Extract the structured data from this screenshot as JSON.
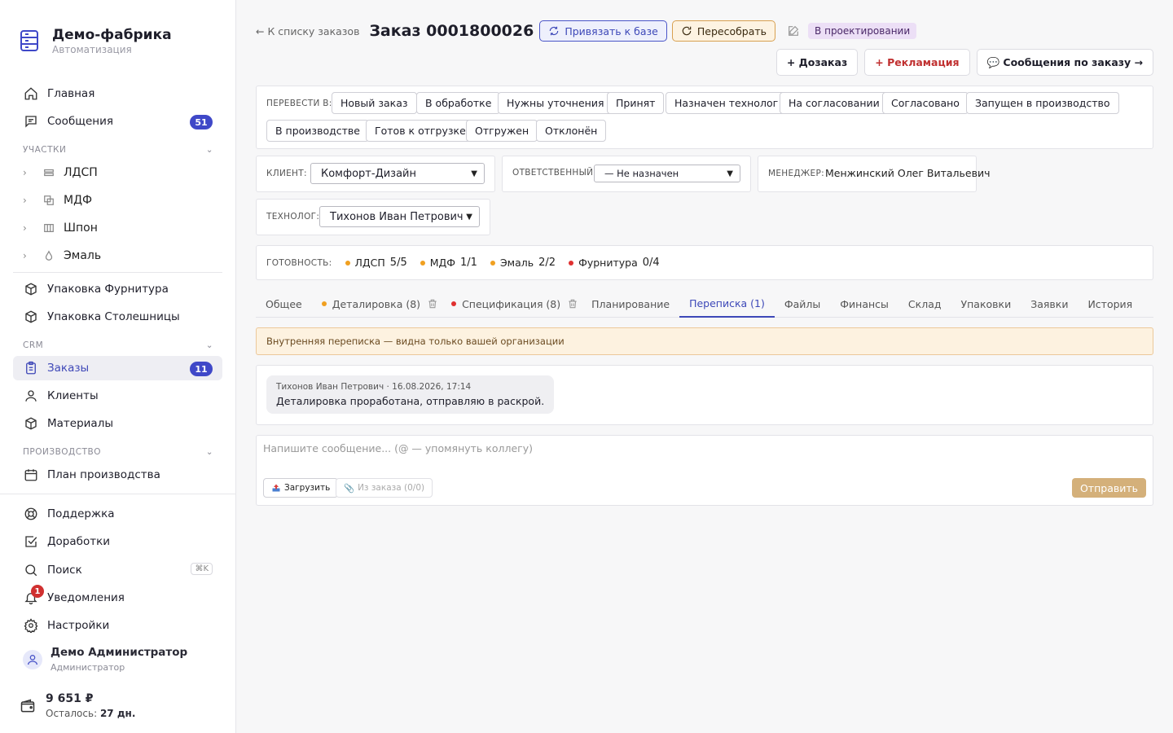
{
  "brand": {
    "name": "Демо-фабрика",
    "subtitle": "Автоматизация"
  },
  "sidebar": {
    "home": "Главная",
    "messages": {
      "label": "Сообщения",
      "count": "51"
    },
    "sections": {
      "areas": "УЧАСТКИ",
      "crm": "CRM",
      "production": "ПРОИЗВОДСТВО"
    },
    "areas": [
      "ЛДСП",
      "МДФ",
      "Шпон",
      "Эмаль"
    ],
    "packing_hardware": "Упаковка Фурнитура",
    "packing_tops": "Упаковка Столешницы",
    "orders": {
      "label": "Заказы",
      "count": "11"
    },
    "clients": "Клиенты",
    "materials": "Материалы",
    "production_plan": "План производства",
    "support": "Поддержка",
    "improvements": "Доработки",
    "search": {
      "label": "Поиск",
      "shortcut": "⌘K"
    },
    "notifications": {
      "label": "Уведомления",
      "count": "1"
    },
    "settings": "Настройки",
    "user": {
      "name": "Демо Администратор",
      "role": "Администратор"
    },
    "wallet": {
      "amount": "9 651 ₽",
      "left_label": "Осталось:",
      "left_value": "27 дн."
    }
  },
  "header": {
    "back": "← К списку заказов",
    "title": "Заказ 0001800026",
    "bind_button": "Привязать к базе",
    "rebuild_button": "Пересобрать",
    "status": "В проектировании",
    "actions": [
      "+ Дозаказ",
      "+ Рекламация",
      "💬 Сообщения по заказу →"
    ]
  },
  "transition": {
    "label": "ПЕРЕВЕСТИ В:",
    "row1": [
      "Новый заказ",
      "В обработке",
      "Нужны уточнения",
      "Принят",
      "Назначен технолог",
      "На согласовании",
      "Согласовано",
      "Запущен в производство"
    ],
    "row2": [
      "В производстве",
      "Готов к отгрузке",
      "Отгружен",
      "Отклонён"
    ]
  },
  "fields": {
    "client": {
      "label": "КЛИЕНТ:",
      "value": "Комфорт-Дизайн"
    },
    "responsible": {
      "label": "ОТВЕТСТВЕННЫЙ:",
      "value": "— Не назначен"
    },
    "manager": {
      "label": "МЕНЕДЖЕР:",
      "value": "Менжинский Олег Витальевич"
    },
    "technologist": {
      "label": "ТЕХНОЛОГ:",
      "value": "Тихонов Иван Петрович"
    }
  },
  "readiness": {
    "label": "ГОТОВНОСТЬ:",
    "items": [
      {
        "name": "ЛДСП",
        "value": "5/5",
        "color": "#f0a020"
      },
      {
        "name": "МДФ",
        "value": "1/1",
        "color": "#f0a020"
      },
      {
        "name": "Эмаль",
        "value": "2/2",
        "color": "#f0a020"
      },
      {
        "name": "Фурнитура",
        "value": "0/4",
        "color": "#e03030"
      }
    ]
  },
  "tabs": {
    "general": "Общее",
    "detailing": "Деталировка (8)",
    "spec": "Спецификация (8)",
    "planning": "Планирование",
    "chat": "Переписка (1)",
    "files": "Файлы",
    "finance": "Финансы",
    "warehouse": "Склад",
    "packing": "Упаковки",
    "requests": "Заявки",
    "history": "История"
  },
  "chat": {
    "notice": "Внутренняя переписка — видна только вашей организации",
    "message": {
      "meta": "Тихонов Иван Петрович · 16.08.2026, 17:14",
      "text": "Деталировка проработана, отправляю в раскрой."
    },
    "placeholder": "Напишите сообщение... (@ — упомянуть коллегу)",
    "upload": "Загрузить",
    "from_order": "Из заказа (0/0)",
    "send": "Отправить"
  }
}
